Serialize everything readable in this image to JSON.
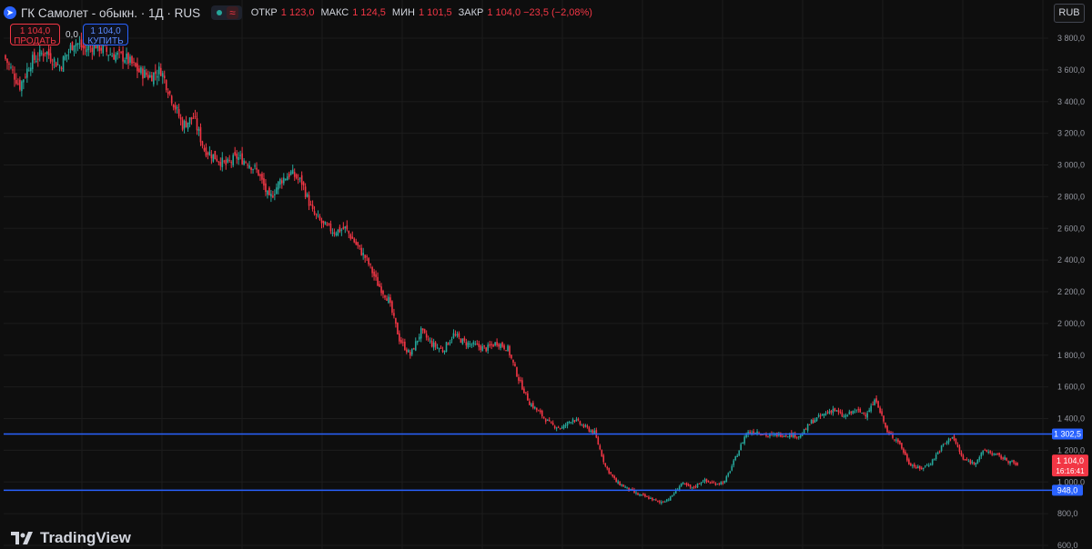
{
  "header": {
    "symbol_title": "ГК Самолет - обыкн. · 1Д · RUS",
    "ohlc": [
      {
        "k": "ОТКР",
        "v": "1 123,0"
      },
      {
        "k": "МАКС",
        "v": "1 124,5"
      },
      {
        "k": "МИН",
        "v": "1 101,5"
      },
      {
        "k": "ЗАКР",
        "v": "1 104,0 −23,5 (−2,08%)"
      }
    ]
  },
  "trade": {
    "sell_price": "1 104,0",
    "sell_label": "ПРОДАТЬ",
    "spread": "0,0",
    "buy_price": "1 104,0",
    "buy_label": "КУПИТЬ"
  },
  "currency": "RUB",
  "logo_text": "TradingView",
  "colors": {
    "up": "#26a69a",
    "down": "#f23645",
    "hline": "#2962ff",
    "background": "#0e0e0e",
    "grid": "#1c1c1c"
  },
  "chart_data": {
    "type": "candlestick",
    "ylim": [
      600,
      3900
    ],
    "y_ticks": [
      600,
      800,
      1000,
      1200,
      1400,
      1600,
      1800,
      2000,
      2200,
      2400,
      2600,
      2800,
      3000,
      3200,
      3400,
      3600,
      3800
    ],
    "y_tick_labels": [
      "600,0",
      "800,0",
      "1 000,0",
      "1 200,0",
      "1 400,0",
      "1 600,0",
      "1 800,0",
      "2 000,0",
      "2 200,0",
      "2 400,0",
      "2 600,0",
      "2 800,0",
      "3 000,0",
      "3 200,0",
      "3 400,0",
      "3 600,0",
      "3 800,0"
    ],
    "grid": true,
    "horizontal_levels": [
      {
        "value": 1302.5,
        "label": "1 302,5"
      },
      {
        "value": 948.0,
        "label": "948,0"
      }
    ],
    "last_price": {
      "value": 1104.0,
      "label": "1 104,0",
      "countdown": "16:16:41"
    },
    "ohlc_stats": {
      "open": 1123.0,
      "high": 1124.5,
      "low": 1101.5,
      "close": 1104.0,
      "change": -23.5,
      "change_pct": -2.08
    },
    "close_path": [
      [
        0,
        3670
      ],
      [
        8,
        3500
      ],
      [
        14,
        3650
      ],
      [
        22,
        3720
      ],
      [
        30,
        3620
      ],
      [
        38,
        3780
      ],
      [
        44,
        3730
      ],
      [
        50,
        3760
      ],
      [
        58,
        3700
      ],
      [
        66,
        3680
      ],
      [
        74,
        3590
      ],
      [
        80,
        3560
      ],
      [
        86,
        3600
      ],
      [
        92,
        3420
      ],
      [
        98,
        3250
      ],
      [
        104,
        3300
      ],
      [
        110,
        3100
      ],
      [
        116,
        3050
      ],
      [
        122,
        3000
      ],
      [
        128,
        3050
      ],
      [
        134,
        3020
      ],
      [
        140,
        2950
      ],
      [
        146,
        2780
      ],
      [
        152,
        2900
      ],
      [
        158,
        2950
      ],
      [
        164,
        2890
      ],
      [
        170,
        2700
      ],
      [
        176,
        2620
      ],
      [
        182,
        2580
      ],
      [
        188,
        2600
      ],
      [
        194,
        2500
      ],
      [
        200,
        2400
      ],
      [
        206,
        2250
      ],
      [
        212,
        2150
      ],
      [
        218,
        1900
      ],
      [
        224,
        1800
      ],
      [
        230,
        1950
      ],
      [
        236,
        1870
      ],
      [
        242,
        1830
      ],
      [
        248,
        1930
      ],
      [
        254,
        1880
      ],
      [
        260,
        1860
      ],
      [
        266,
        1840
      ],
      [
        272,
        1880
      ],
      [
        278,
        1840
      ],
      [
        284,
        1650
      ],
      [
        290,
        1500
      ],
      [
        296,
        1430
      ],
      [
        302,
        1360
      ],
      [
        308,
        1340
      ],
      [
        314,
        1400
      ],
      [
        320,
        1350
      ],
      [
        326,
        1310
      ],
      [
        332,
        1100
      ],
      [
        338,
        1000
      ],
      [
        344,
        960
      ],
      [
        350,
        920
      ],
      [
        356,
        900
      ],
      [
        362,
        870
      ],
      [
        368,
        900
      ],
      [
        374,
        990
      ],
      [
        380,
        960
      ],
      [
        386,
        1010
      ],
      [
        392,
        990
      ],
      [
        398,
        1000
      ],
      [
        404,
        1150
      ],
      [
        410,
        1310
      ],
      [
        416,
        1320
      ],
      [
        422,
        1290
      ],
      [
        428,
        1300
      ],
      [
        434,
        1300
      ],
      [
        440,
        1290
      ],
      [
        446,
        1380
      ],
      [
        452,
        1420
      ],
      [
        458,
        1460
      ],
      [
        464,
        1410
      ],
      [
        470,
        1450
      ],
      [
        476,
        1430
      ],
      [
        482,
        1520
      ],
      [
        488,
        1310
      ],
      [
        494,
        1260
      ],
      [
        500,
        1120
      ],
      [
        506,
        1080
      ],
      [
        512,
        1120
      ],
      [
        518,
        1220
      ],
      [
        524,
        1290
      ],
      [
        530,
        1140
      ],
      [
        536,
        1120
      ],
      [
        542,
        1200
      ],
      [
        548,
        1170
      ],
      [
        554,
        1140
      ],
      [
        560,
        1104
      ]
    ]
  }
}
